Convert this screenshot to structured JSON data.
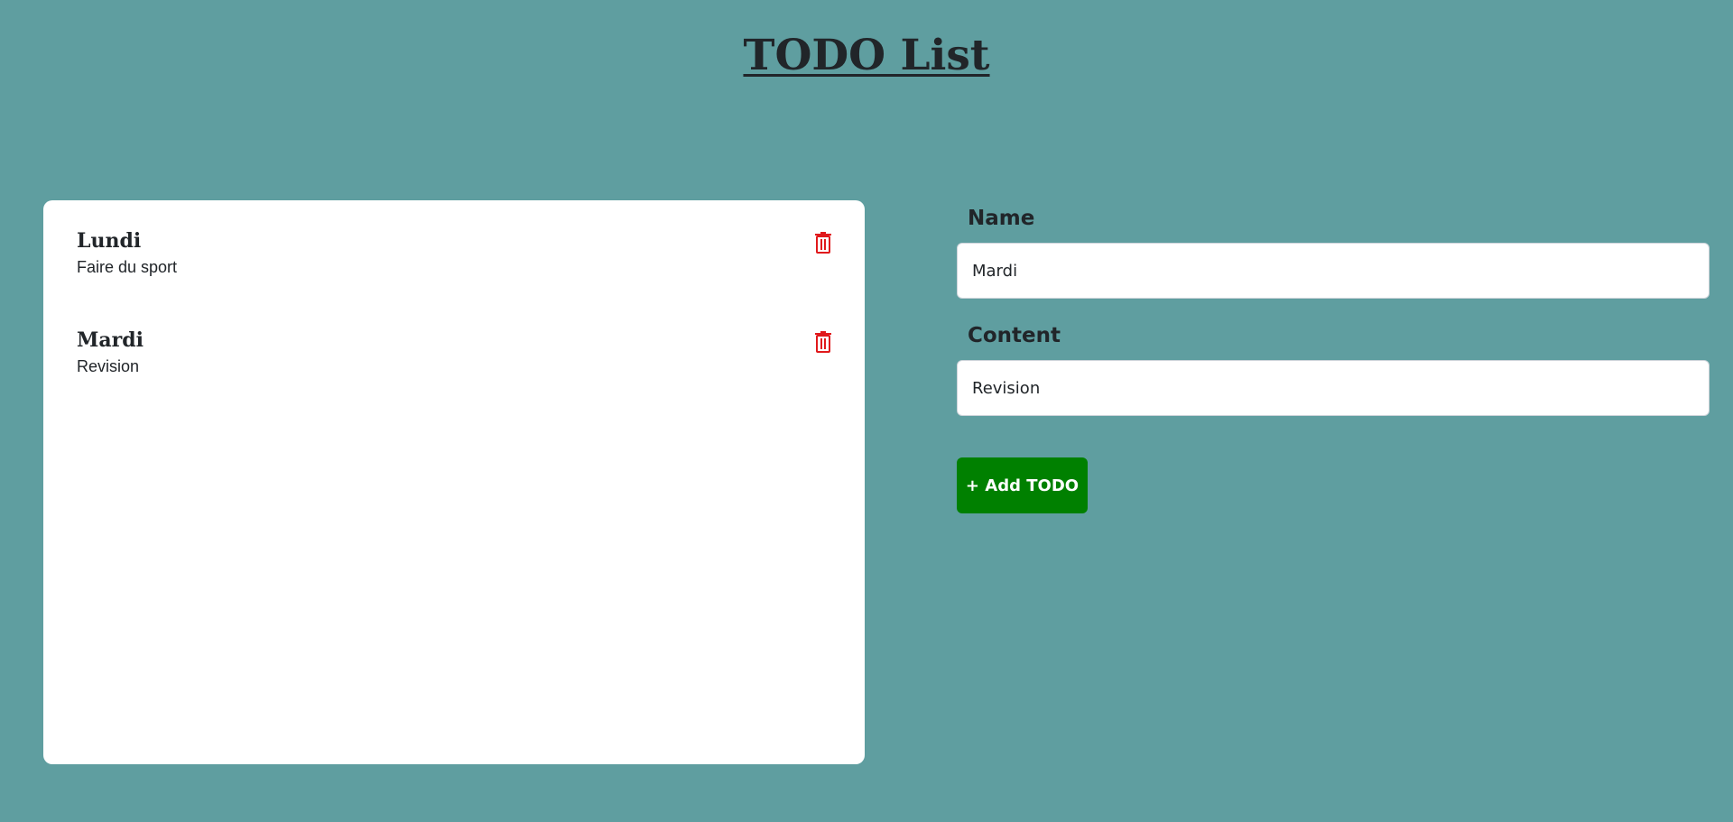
{
  "header": {
    "title": "TODO List"
  },
  "todos": [
    {
      "name": "Lundi",
      "content": "Faire du sport"
    },
    {
      "name": "Mardi",
      "content": "Revision"
    }
  ],
  "form": {
    "name_label": "Name",
    "name_value": "Mardi",
    "content_label": "Content",
    "content_value": "Revision",
    "add_button_label": "+ Add TODO"
  },
  "colors": {
    "background": "#5f9ea0",
    "delete_icon": "#e0191c",
    "add_button": "#008000"
  },
  "icons": {
    "delete": "trash-icon"
  }
}
